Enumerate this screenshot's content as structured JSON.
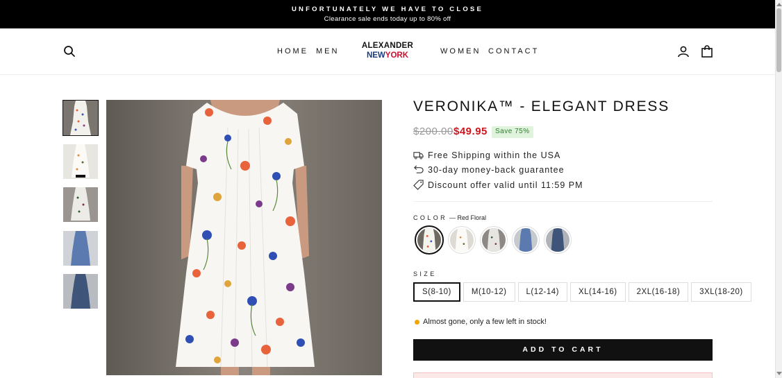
{
  "announcement": {
    "title": "UNFORTUNATELY WE HAVE TO CLOSE",
    "subtitle": "Clearance sale ends today up to 80% off"
  },
  "header": {
    "nav_left": [
      "HOME",
      "MEN"
    ],
    "nav_right": [
      "WOMEN",
      "CONTACT"
    ],
    "logo": {
      "line1": "ALEXANDER",
      "line2a": "NEW",
      "line2b": "YORK"
    }
  },
  "product": {
    "title": "VERONIKA™ - ELEGANT DRESS",
    "old_price": "$200.00",
    "price": "$49.95",
    "save_badge": "Save 75%",
    "benefits": [
      {
        "icon": "truck-icon",
        "text": "Free Shipping within the USA"
      },
      {
        "icon": "return-icon",
        "text": "30-day money-back guarantee"
      },
      {
        "icon": "tag-icon",
        "text": "Discount offer valid until 11:59 PM"
      }
    ],
    "color_label": "COLOR",
    "color_selected": "— Red Floral",
    "size_label": "SIZE",
    "sizes": [
      "S(8-10)",
      "M(10-12)",
      "L(12-14)",
      "XL(14-16)",
      "2XL(16-18)",
      "3XL(18-20)"
    ],
    "selected_size_index": 0,
    "stock_text": "Almost gone, only a few left in stock!",
    "add_to_cart": "ADD TO CART"
  },
  "colors": {
    "accent_red": "#d0141e",
    "badge_bg": "#dff3dd",
    "badge_text": "#2f7a2f",
    "stock_dot": "#f0a500"
  },
  "swatch_variants": [
    "red-floral",
    "white-floral",
    "dark-floral",
    "blue",
    "navy"
  ]
}
